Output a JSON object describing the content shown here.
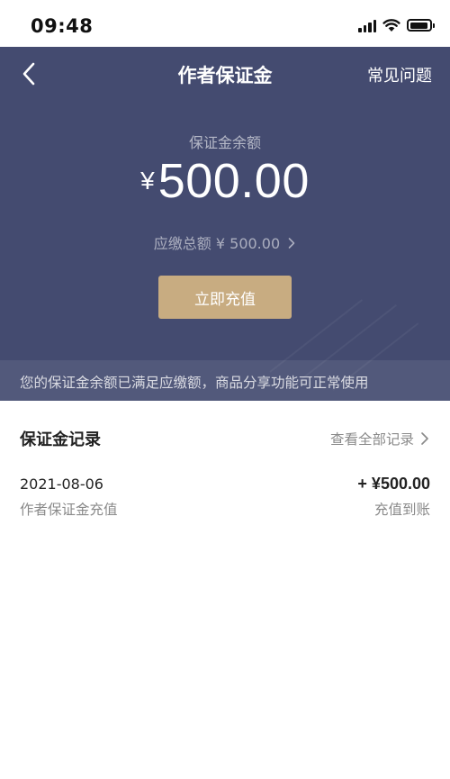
{
  "status_bar": {
    "time": "09:48",
    "icons": [
      "signal-icon",
      "wifi-icon",
      "battery-icon"
    ]
  },
  "header": {
    "title": "作者保证金",
    "back_icon": "chevron-left-icon",
    "faq_label": "常见问题"
  },
  "balance": {
    "label": "保证金余额",
    "currency": "¥",
    "amount": "500.00",
    "total_due": "应缴总额 ¥ 500.00",
    "total_due_icon": "chevron-right-icon"
  },
  "actions": {
    "recharge_label": "立即充值"
  },
  "notice": {
    "text": "您的保证金余额已满足应缴额，商品分享功能可正常使用"
  },
  "records": {
    "title": "保证金记录",
    "view_all_label": "查看全部记录",
    "items": [
      {
        "date": "2021-08-06",
        "description": "作者保证金充值",
        "amount": "+ ¥500.00",
        "status": "充值到账"
      }
    ]
  },
  "colors": {
    "hero_background": "#444b70",
    "button_gold": "#c8ac81",
    "secondary_text": "#8a8a8a"
  }
}
